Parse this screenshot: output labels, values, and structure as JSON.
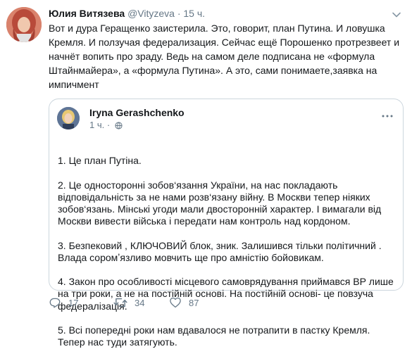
{
  "tweet": {
    "author_name": "Юлия Витязева",
    "handle": "@Vityzeva",
    "separator": "·",
    "time": "15 ч.",
    "text": "Вот и дура Геращенко заистерила. Это, говорит, план Путина. И ловушка Кремля. И ползучая федерализация. Сейчас ещё Порошенко протрезвеет и начнёт вопить про зраду. Ведь на самом деле подписана не «формула Штайнмайера», а «формула Путина». А это, сами понимаете,заявка на импичмент"
  },
  "quoted_tweet": {
    "author_name": "Iryna Gerashchenko",
    "time": "1 ч.",
    "separator": "·",
    "lines": [
      "1.  Це план Путіна.",
      "2. Це односторонні зобов‘язання України, на нас покладають відповідальність за не нами розв‘язану війну.  В Москви тепер ніяких зобов‘язань. Мінські угоди мали двосторонній характер. І вимагали від Москви вивести війська і передати нам контроль над кордоном.",
      "3. Безпековий , КЛЮЧОВИЙ блок, зник. Залишився тільки політичний . Влада соромʼязливо мовчить ще про амністію бойовикам.",
      "4. Закон про особливості місцевого самоврядування приймався ВР лише   на три роки, а не на постійній основі. На постійній основі- це повзуча федералізація.",
      "5. Всі попередні роки нам вдавалося не потрапити в пастку Кремля. Тепер нас туди затягують."
    ]
  },
  "actions": {
    "replies": "17",
    "retweets": "34",
    "likes": "87"
  },
  "icons": {
    "reply": "reply-icon",
    "retweet": "retweet-icon",
    "like": "heart-icon",
    "more": "chevron-down-icon",
    "quote_more": "more-dots-icon",
    "visibility": "globe-icon"
  },
  "colors": {
    "text": "#14171a",
    "muted": "#657786",
    "border": "#ccd6dd"
  }
}
